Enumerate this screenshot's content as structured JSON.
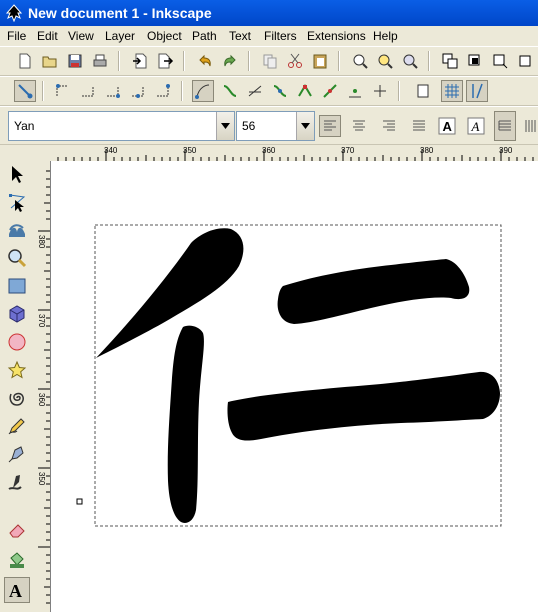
{
  "window": {
    "title": "New document 1 - Inkscape"
  },
  "menu": [
    "File",
    "Edit",
    "View",
    "Layer",
    "Object",
    "Path",
    "Text",
    "Filters",
    "Extensions",
    "Help"
  ],
  "text_toolbar": {
    "font_family": "Yan",
    "font_size": "56",
    "align_options": [
      "align-left",
      "align-center",
      "align-right",
      "align-justify"
    ],
    "style_options": [
      "bold",
      "italic"
    ]
  },
  "ruler": {
    "top_labels": [
      "340",
      "350",
      "360",
      "370",
      "380",
      "390"
    ],
    "left_labels": [
      "380",
      "370",
      "360",
      "350"
    ]
  },
  "canvas": {
    "glyph": "仁",
    "glyph_color": "#000000",
    "page_color": "#ffffff"
  },
  "tools": [
    "selector-tool",
    "node-tool",
    "tweak-tool",
    "zoom-tool",
    "rectangle-tool",
    "3d-box-tool",
    "ellipse-tool",
    "star-tool",
    "spiral-tool",
    "pencil-tool",
    "pen-tool",
    "calligraphy-tool",
    "eraser-tool",
    "paint-bucket-tool",
    "text-tool"
  ]
}
